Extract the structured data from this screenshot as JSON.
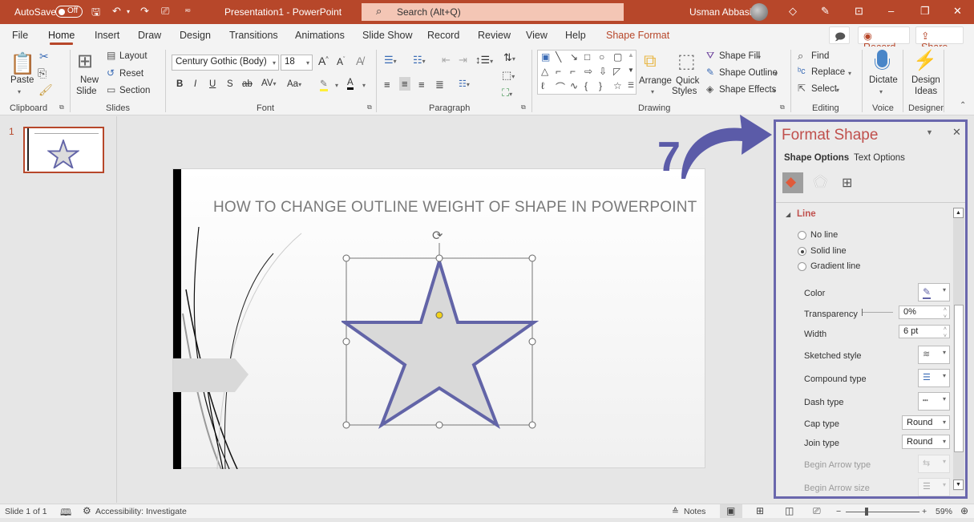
{
  "titlebar": {
    "autosave_label": "AutoSave",
    "autosave_state": "Off",
    "title": "Presentation1  -  PowerPoint",
    "search_placeholder": "Search (Alt+Q)",
    "user_name": "Usman Abbasi"
  },
  "menu": {
    "tabs": [
      "File",
      "Home",
      "Insert",
      "Draw",
      "Design",
      "Transitions",
      "Animations",
      "Slide Show",
      "Record",
      "Review",
      "View",
      "Help",
      "Shape Format"
    ],
    "active_tab": "Home",
    "record_button": "Record",
    "share_button": "Share"
  },
  "ribbon": {
    "clipboard": {
      "paste": "Paste",
      "label": "Clipboard"
    },
    "slides": {
      "new_slide_1": "New",
      "new_slide_2": "Slide",
      "layout": "Layout",
      "reset": "Reset",
      "section": "Section",
      "label": "Slides"
    },
    "font": {
      "font_name": "Century Gothic (Body)",
      "font_size": "18",
      "label": "Font"
    },
    "paragraph": {
      "label": "Paragraph"
    },
    "drawing": {
      "arrange": "Arrange",
      "quick_styles_1": "Quick",
      "quick_styles_2": "Styles",
      "shape_fill": "Shape Fill",
      "shape_outline": "Shape Outline",
      "shape_effects": "Shape Effects",
      "label": "Drawing"
    },
    "editing": {
      "find": "Find",
      "replace": "Replace",
      "select": "Select",
      "label": "Editing"
    },
    "voice": {
      "dictate": "Dictate",
      "label": "Voice"
    },
    "designer": {
      "design_ideas_1": "Design",
      "design_ideas_2": "Ideas",
      "label": "Designer"
    }
  },
  "thumbnails": [
    {
      "number": "1"
    }
  ],
  "slide": {
    "title": "HOW TO CHANGE OUTLINE WEIGHT OF SHAPE IN POWERPOINT",
    "shape": "5-point star",
    "shape_fill": "#d9d9d9",
    "shape_outline": "#6264a7"
  },
  "annotation": {
    "step_number": "7",
    "color": "#5b5ba8"
  },
  "format_pane": {
    "title": "Format Shape",
    "tabs": [
      "Shape Options",
      "Text Options"
    ],
    "active_tab": "Shape Options",
    "section": "Line",
    "line_options": [
      {
        "label": "No line",
        "selected": false
      },
      {
        "label": "Solid line",
        "selected": true
      },
      {
        "label": "Gradient line",
        "selected": false
      }
    ],
    "properties": {
      "color_label": "Color",
      "transparency_label": "Transparency",
      "transparency_value": "0%",
      "width_label": "Width",
      "width_value": "6 pt",
      "sketched_label": "Sketched style",
      "compound_label": "Compound type",
      "dash_label": "Dash type",
      "cap_label": "Cap type",
      "cap_value": "Round",
      "join_label": "Join type",
      "join_value": "Round",
      "begin_arrow_type_label": "Begin Arrow type",
      "begin_arrow_size_label": "Begin Arrow size"
    }
  },
  "status": {
    "slide_info": "Slide 1 of 1",
    "accessibility": "Accessibility: Investigate",
    "notes": "Notes",
    "zoom": "59%"
  }
}
